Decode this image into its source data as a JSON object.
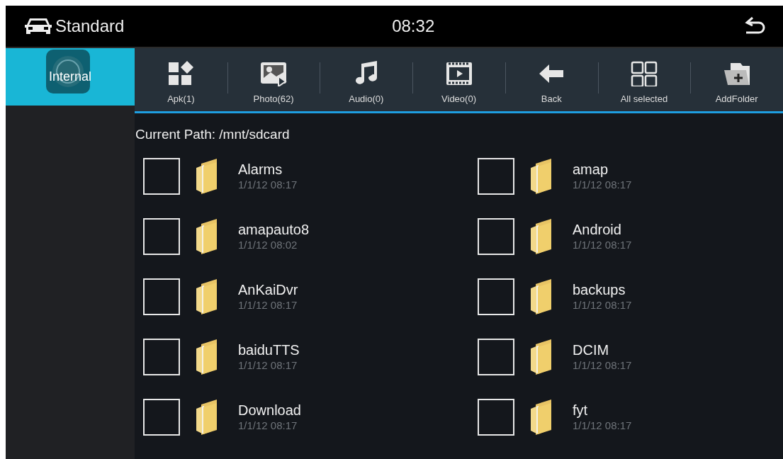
{
  "status_bar": {
    "mode": "Standard",
    "time": "08:32"
  },
  "sidebar": {
    "items": [
      {
        "label": "Internal",
        "selected": true
      }
    ]
  },
  "toolbar": [
    {
      "label": "Apk(1)",
      "kind": "apk"
    },
    {
      "label": "Photo(62)",
      "kind": "photo"
    },
    {
      "label": "Audio(0)",
      "kind": "audio"
    },
    {
      "label": "Video(0)",
      "kind": "video"
    },
    {
      "label": "Back",
      "kind": "back"
    },
    {
      "label": "All selected",
      "kind": "selectall"
    },
    {
      "label": "AddFolder",
      "kind": "addfolder"
    }
  ],
  "current_path": "Current Path: /mnt/sdcard",
  "files": [
    {
      "name": "Alarms",
      "date": "1/1/12 08:17",
      "checked": false
    },
    {
      "name": "amap",
      "date": "1/1/12 08:17",
      "checked": false
    },
    {
      "name": "amapauto8",
      "date": "1/1/12 08:02",
      "checked": false
    },
    {
      "name": "Android",
      "date": "1/1/12 08:17",
      "checked": false
    },
    {
      "name": "AnKaiDvr",
      "date": "1/1/12 08:17",
      "checked": false
    },
    {
      "name": "backups",
      "date": "1/1/12 08:17",
      "checked": false
    },
    {
      "name": "baiduTTS",
      "date": "1/1/12 08:17",
      "checked": false
    },
    {
      "name": "DCIM",
      "date": "1/1/12 08:17",
      "checked": false
    },
    {
      "name": "Download",
      "date": "1/1/12 08:17",
      "checked": false
    },
    {
      "name": "fyt",
      "date": "1/1/12 08:17",
      "checked": false
    }
  ]
}
